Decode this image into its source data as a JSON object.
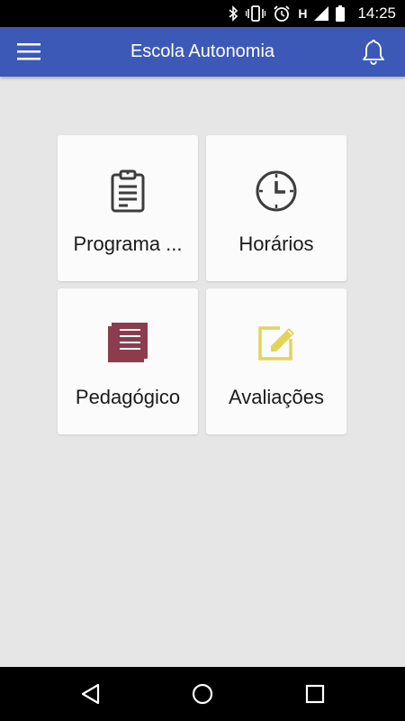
{
  "status_bar": {
    "time": "14:25",
    "network_letter": "H",
    "icons": [
      "bluetooth-icon",
      "vibrate-icon",
      "alarm-icon",
      "network-h-icon",
      "signal-icon",
      "battery-icon"
    ]
  },
  "app_bar": {
    "title": "Escola Autonomia",
    "menu_icon": "hamburger-menu-icon",
    "notification_icon": "bell-icon",
    "background": "#3c59b8"
  },
  "cards": [
    {
      "label": "Programa ...",
      "icon": "clipboard-icon",
      "icon_color": "#3d3d3d"
    },
    {
      "label": "Horários",
      "icon": "clock-icon",
      "icon_color": "#3d3d3d"
    },
    {
      "label": "Pedagógico",
      "icon": "book-icon",
      "icon_color": "#8b3d4f"
    },
    {
      "label": "Avaliações",
      "icon": "edit-icon",
      "icon_color": "#e2d45a"
    }
  ],
  "nav_bar": {
    "buttons": [
      "back-icon",
      "home-icon",
      "recents-icon"
    ]
  }
}
